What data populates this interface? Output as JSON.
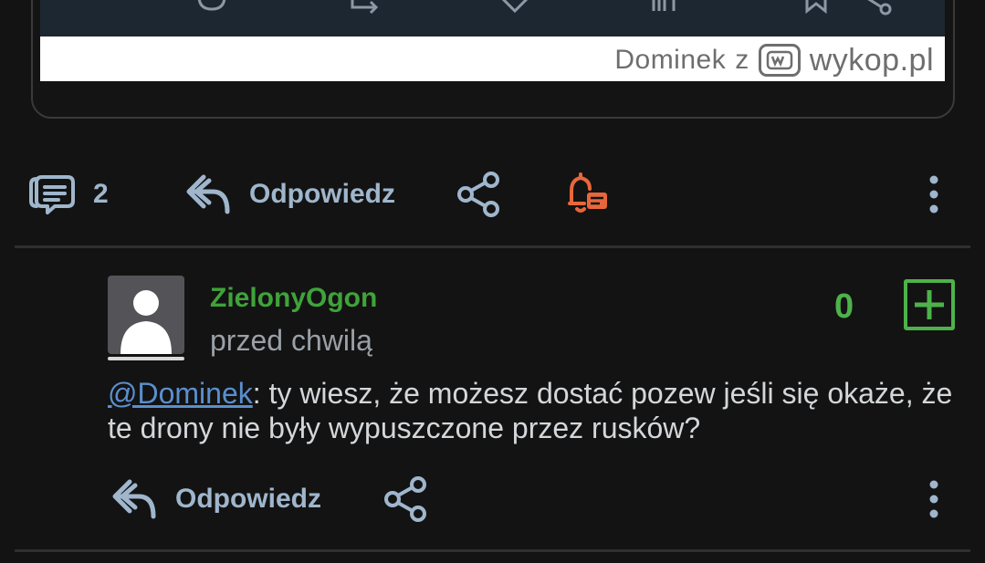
{
  "embed": {
    "watermark_user": "Dominek",
    "watermark_sep": "z",
    "watermark_brand": "wykop.pl"
  },
  "post_actions": {
    "comment_count": "2",
    "reply_label": "Odpowiedz"
  },
  "comment": {
    "username": "ZielonyOgon",
    "timestamp": "przed chwilą",
    "vote_count": "0",
    "mention": "@Dominek",
    "text": ": ty wiesz, że możesz dostać pozew jeśli się okaże, że te drony nie były wypuszczone przez rusków?",
    "reply_label": "Odpowiedz"
  },
  "colors": {
    "background": "#131313",
    "action_text": "#9fb6cc",
    "username": "#3fa33a",
    "vote_green": "#4db24a",
    "bell_orange": "#e8673a",
    "mention_blue": "#5a8fcf"
  }
}
